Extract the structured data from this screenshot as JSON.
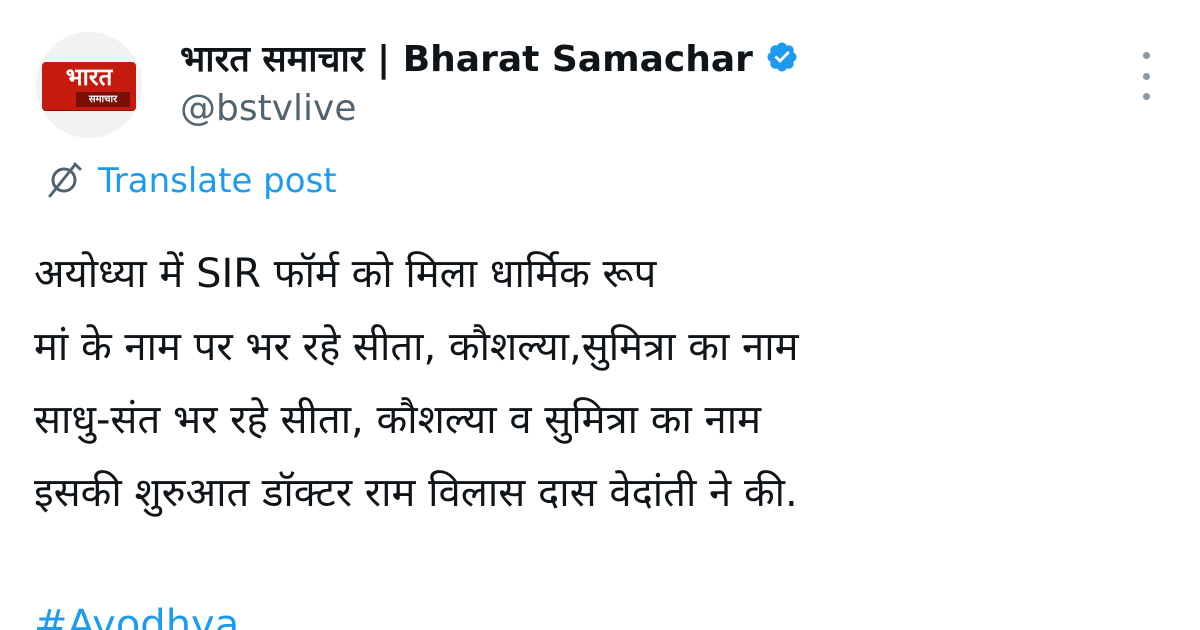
{
  "account": {
    "display_name": "भारत समाचार | Bharat Samachar",
    "handle": "@bstvlive",
    "avatar_logo_main": "भारत",
    "avatar_logo_sub": "समाचार",
    "verified": true
  },
  "icons": {
    "verified": "verified-badge-icon",
    "more": "more-options-icon",
    "translate": "translate-icon"
  },
  "translate": {
    "label": "Translate post"
  },
  "post": {
    "lines": [
      "अयोध्या में SIR फॉर्म को मिला धार्मिक रूप",
      "मां के नाम पर भर रहे सीता, कौशल्या,सुमित्रा का नाम",
      "साधु-संत भर रहे सीता, कौशल्या व सुमित्रा का नाम",
      "इसकी शुरुआत डॉक्टर राम विलास दास वेदांती ने की."
    ],
    "hashtag": "#Ayodhya"
  },
  "colors": {
    "link": "#1d9bf0",
    "text": "#0f1419",
    "secondary_text": "#536471",
    "brand_red": "#c51a0e"
  }
}
